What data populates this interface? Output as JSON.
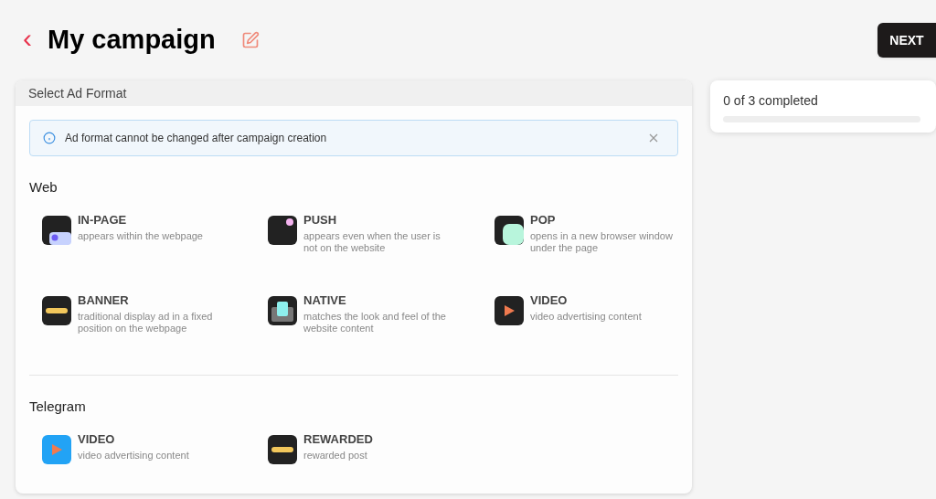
{
  "header": {
    "back": "‹",
    "title": "My campaign",
    "next": "NEXT"
  },
  "card": {
    "title": "Select Ad Format",
    "notice": "Ad format cannot be changed after campaign creation",
    "sections": [
      {
        "title": "Web",
        "formats": [
          {
            "kind": "inpage",
            "name": "IN-PAGE",
            "description": "appears within the webpage"
          },
          {
            "kind": "push",
            "name": "PUSH",
            "description": "appears even when the user is not on the website"
          },
          {
            "kind": "pop",
            "name": "POP",
            "description": "opens in a new browser window under the page"
          },
          {
            "kind": "banner",
            "name": "BANNER",
            "description": "traditional display ad in a fixed position on the webpage"
          },
          {
            "kind": "native",
            "name": "NATIVE",
            "description": "matches the look and feel of the website content"
          },
          {
            "kind": "video",
            "name": "VIDEO",
            "description": "video advertising content"
          }
        ]
      },
      {
        "title": "Telegram",
        "formats": [
          {
            "kind": "video_blue",
            "name": "VIDEO",
            "description": "video advertising content"
          },
          {
            "kind": "banner",
            "name": "REWARDED",
            "description": "rewarded post"
          }
        ]
      }
    ]
  },
  "progress": {
    "label": "0 of 3 completed",
    "level": 0
  }
}
